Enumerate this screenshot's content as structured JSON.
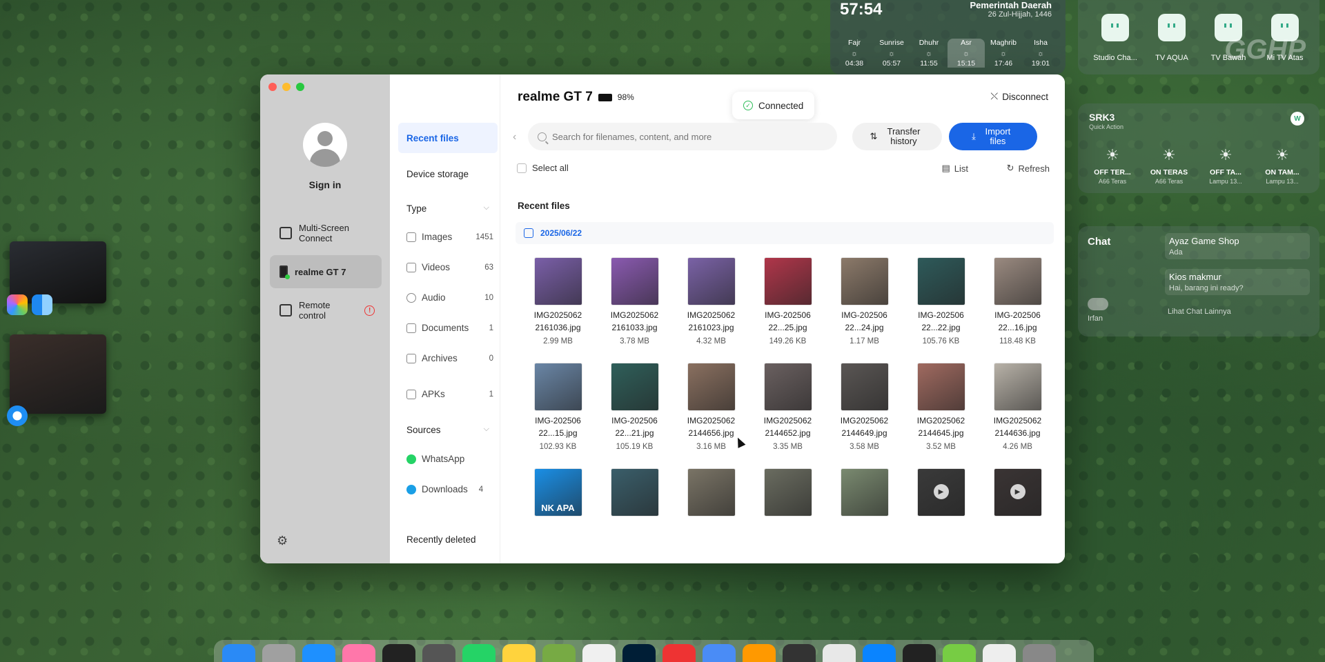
{
  "window": {
    "left": {
      "sign_in": "Sign in",
      "nav": [
        {
          "label": "Multi-Screen Connect"
        },
        {
          "label": "realme GT 7"
        },
        {
          "label": "Remote control"
        }
      ]
    },
    "mid": {
      "recent": "Recent files",
      "storage": "Device storage",
      "type_header": "Type",
      "types": [
        {
          "label": "Images",
          "count": "1451"
        },
        {
          "label": "Videos",
          "count": "63"
        },
        {
          "label": "Audio",
          "count": "10"
        },
        {
          "label": "Documents",
          "count": "1"
        },
        {
          "label": "Archives",
          "count": "0"
        },
        {
          "label": "APKs",
          "count": "1"
        }
      ],
      "sources_header": "Sources",
      "sources": [
        {
          "label": "WhatsApp",
          "count": "",
          "color": "#25d366"
        },
        {
          "label": "Downloads",
          "count": "4",
          "color": "#1a9fe6"
        }
      ],
      "deleted": "Recently deleted"
    },
    "content": {
      "device_name": "realme GT 7",
      "battery": "98%",
      "connected": "Connected",
      "disconnect": "Disconnect",
      "search_placeholder": "Search for filenames, content, and more",
      "transfer": "Transfer history",
      "import": "Import files",
      "select_all": "Select all",
      "list": "List",
      "refresh": "Refresh",
      "section_title": "Recent files",
      "date": "2025/06/22",
      "files": [
        {
          "name1": "IMG2025062",
          "name2": "2161036.jpg",
          "size": "2.99 MB",
          "color": "#7a5fa8"
        },
        {
          "name1": "IMG2025062",
          "name2": "2161033.jpg",
          "size": "3.78 MB",
          "color": "#8a5ab0"
        },
        {
          "name1": "IMG2025062",
          "name2": "2161023.jpg",
          "size": "4.32 MB",
          "color": "#7a62a6"
        },
        {
          "name1": "IMG-202506",
          "name2": "22...25.jpg",
          "size": "149.26 KB",
          "color": "#b0364a"
        },
        {
          "name1": "IMG-202506",
          "name2": "22...24.jpg",
          "size": "1.17 MB",
          "color": "#8c7a6a"
        },
        {
          "name1": "IMG-202506",
          "name2": "22...22.jpg",
          "size": "105.76 KB",
          "color": "#2e5a5a"
        },
        {
          "name1": "IMG-202506",
          "name2": "22...16.jpg",
          "size": "118.48 KB",
          "color": "#9a8a80"
        },
        {
          "name1": "IMG-202506",
          "name2": "22...15.jpg",
          "size": "102.93 KB",
          "color": "#6a86a6"
        },
        {
          "name1": "IMG-202506",
          "name2": "22...21.jpg",
          "size": "105.19 KB",
          "color": "#2f5f5a"
        },
        {
          "name1": "IMG2025062",
          "name2": "2144656.jpg",
          "size": "3.16 MB",
          "color": "#8a7060"
        },
        {
          "name1": "IMG2025062",
          "name2": "2144652.jpg",
          "size": "3.35 MB",
          "color": "#6a6060"
        },
        {
          "name1": "IMG2025062",
          "name2": "2144649.jpg",
          "size": "3.58 MB",
          "color": "#5a5654"
        },
        {
          "name1": "IMG2025062",
          "name2": "2144645.jpg",
          "size": "3.52 MB",
          "color": "#a06a60"
        },
        {
          "name1": "IMG2025062",
          "name2": "2144636.jpg",
          "size": "4.26 MB",
          "color": "#b8b2a8"
        },
        {
          "name1": "",
          "name2": "",
          "size": "",
          "color": "#1a8fe6",
          "caption": "NK APA"
        },
        {
          "name1": "",
          "name2": "",
          "size": "",
          "color": "#3a5e6a"
        },
        {
          "name1": "",
          "name2": "",
          "size": "",
          "color": "#7a7466"
        },
        {
          "name1": "",
          "name2": "",
          "size": "",
          "color": "#6a6c60"
        },
        {
          "name1": "",
          "name2": "",
          "size": "",
          "color": "#7a8a70"
        },
        {
          "name1": "",
          "name2": "",
          "size": "",
          "color": "#3a3a3a",
          "video": true
        },
        {
          "name1": "",
          "name2": "",
          "size": "",
          "color": "#3a3434",
          "video": true
        }
      ]
    }
  },
  "prayer": {
    "time": "57:54",
    "org": "Pemerintah Daerah",
    "date": "26 Zul-Hijjah, 1446",
    "cols": [
      {
        "name": "Fajr",
        "time": "04:38"
      },
      {
        "name": "Sunrise",
        "time": "05:57"
      },
      {
        "name": "Dhuhr",
        "time": "11:55"
      },
      {
        "name": "Asr",
        "time": "15:15"
      },
      {
        "name": "Maghrib",
        "time": "17:46"
      },
      {
        "name": "Isha",
        "time": "19:01"
      }
    ]
  },
  "home": {
    "devices": [
      "Studio Cha...",
      "TV AQUA",
      "TV Bawah",
      "Mi TV Atas"
    ]
  },
  "srk": {
    "title": "SRK3",
    "subtitle": "Quick Action",
    "badge": "W",
    "actions": [
      {
        "label": "OFF TER...",
        "sub": "A66 Teras"
      },
      {
        "label": "ON TERAS",
        "sub": "A66 Teras"
      },
      {
        "label": "OFF TA...",
        "sub": "Lampu 13..."
      },
      {
        "label": "ON TAM...",
        "sub": "Lampu 13..."
      }
    ]
  },
  "chat": {
    "title": "Chat",
    "messages": [
      {
        "name": "Ayaz Game Shop",
        "preview": "Ada"
      },
      {
        "name": "Kios makmur",
        "preview": "Hai, barang ini ready?"
      }
    ],
    "user": "Irfan",
    "more": "Lihat Chat Lainnya"
  },
  "watermark": "GGHP"
}
